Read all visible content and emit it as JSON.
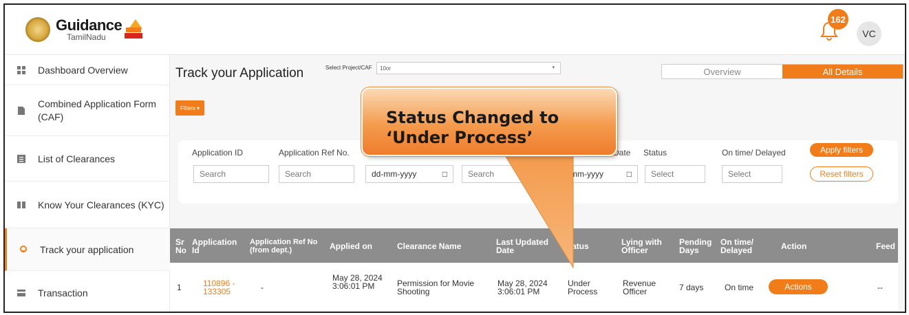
{
  "brand": {
    "title": "Guidance",
    "subtitle": "TamilNadu"
  },
  "header": {
    "notification_count": "162",
    "user_initials": "VC"
  },
  "sidebar": {
    "items": [
      {
        "label": "Dashboard Overview"
      },
      {
        "label": "Combined Application Form (CAF)"
      },
      {
        "label": "List of Clearances"
      },
      {
        "label": "Know Your Clearances (KYC)"
      },
      {
        "label": "Track your application"
      },
      {
        "label": "Transaction"
      }
    ]
  },
  "main": {
    "title": "Track your Application",
    "select_label": "Select Project/CAF",
    "select_value": "10or",
    "tabs": [
      "Overview",
      "All Details"
    ],
    "filters_button": "Filters"
  },
  "filters": {
    "labels": [
      "Application ID",
      "Application Ref No.",
      "Date",
      "Status",
      "On time/ Delayed"
    ],
    "placeholders": [
      "Search",
      "Search",
      "dd-mm-yyyy",
      "Search",
      "mm-yyyy",
      "Select",
      "Select"
    ],
    "apply": "Apply filters",
    "reset": "Reset filters"
  },
  "table": {
    "headers": [
      "Sr No",
      "Application Id",
      "Application Ref No (from dept.)",
      "Applied on",
      "Clearance Name",
      "Last Updated Date",
      "atus",
      "Lying with Officer",
      "Pending Days",
      "On time/ Delayed",
      "Action",
      "Feed"
    ],
    "row": {
      "sr": "1",
      "app_id": "110896 - 133305",
      "ref_no": "-",
      "applied_on": "May 28, 2024 3:06:01 PM",
      "clearance": "Permission for Movie Shooting",
      "last_updated": "May 28, 2024 3:06:01 PM",
      "status": "Under Process",
      "lying_with": "Revenue Officer",
      "pending": "7 days",
      "on_time": "On time",
      "action": "Actions",
      "feedback": "--"
    }
  },
  "callout": {
    "text": "Status Changed to ‘Under Process’"
  },
  "colors": {
    "accent": "#f07d1a",
    "table_header": "#8d8d8d"
  }
}
